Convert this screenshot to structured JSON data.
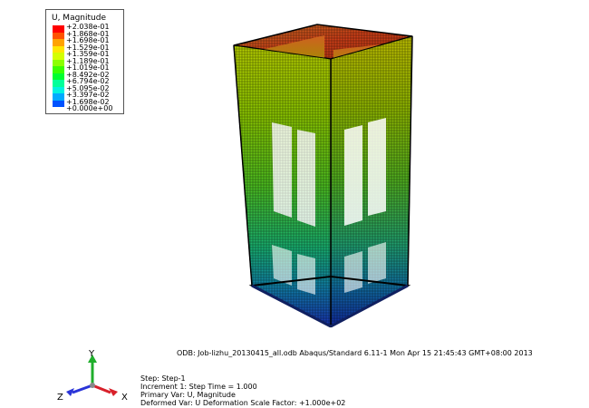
{
  "legend": {
    "title": "U, Magnitude",
    "entries": [
      {
        "label": "+2.038e-01",
        "color": "#ff0000"
      },
      {
        "label": "+1.868e-01",
        "color": "#ff5200"
      },
      {
        "label": "+1.698e-01",
        "color": "#ffa200"
      },
      {
        "label": "+1.529e-01",
        "color": "#ffe600"
      },
      {
        "label": "+1.359e-01",
        "color": "#d4ff00"
      },
      {
        "label": "+1.189e-01",
        "color": "#8cff00"
      },
      {
        "label": "+1.019e-01",
        "color": "#3aff00"
      },
      {
        "label": "+8.492e-02",
        "color": "#00ff30"
      },
      {
        "label": "+6.794e-02",
        "color": "#00ff9a"
      },
      {
        "label": "+5.095e-02",
        "color": "#00f2e0"
      },
      {
        "label": "+3.397e-02",
        "color": "#00aaff"
      },
      {
        "label": "+1.698e-02",
        "color": "#0052ff"
      },
      {
        "label": "+0.000e+00",
        "color": "#0000ff"
      }
    ]
  },
  "odb_line": "ODB: Job-lizhu_20130415_all.odb    Abaqus/Standard 6.11-1    Mon Apr 15 21:45:43 GMT+08:00 2013",
  "step_info": {
    "step": "Step: Step-1",
    "increment": "Increment      1: Step Time =    1.000",
    "primary_var": "Primary Var: U, Magnitude",
    "deformed_var": "Deformed Var: U   Deformation Scale Factor: +1.000e+02"
  },
  "triad": {
    "x_label": "X",
    "y_label": "Y",
    "z_label": "Z",
    "x_color": "#d8202a",
    "y_color": "#1fae2b",
    "z_color": "#2a34d8"
  }
}
